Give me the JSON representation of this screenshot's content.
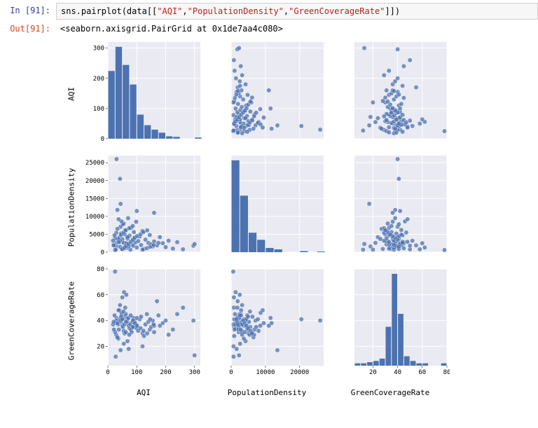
{
  "cell": {
    "in_prompt": "In [91]:",
    "out_prompt": "Out[91]:",
    "code_prefix": "sns.pairplot(data[[",
    "code_s1": "\"AQI\"",
    "code_c1": ",",
    "code_s2": "\"PopulationDensity\"",
    "code_c2": ",",
    "code_s3": "\"GreenCoverageRate\"",
    "code_suffix": "]])",
    "output_text": "<seaborn.axisgrid.PairGrid at 0x1de7aa4c080>"
  },
  "chart_data": {
    "type": "pairplot",
    "variables": [
      "AQI",
      "PopulationDensity",
      "GreenCoverageRate"
    ],
    "xlabels": [
      "AQI",
      "PopulationDensity",
      "GreenCoverageRate"
    ],
    "ylabels": [
      "AQI",
      "PopulationDensity",
      "GreenCoverageRate"
    ],
    "axes": {
      "AQI": {
        "min": 0,
        "max": 320,
        "ticks": [
          0,
          100,
          200,
          300
        ]
      },
      "PopulationDensity": {
        "min": 0,
        "max": 27000,
        "ticks": [
          0,
          10000,
          20000
        ]
      },
      "GreenCoverageRate": {
        "min": 5,
        "max": 80,
        "ticks": [
          20,
          40,
          60,
          80
        ]
      }
    },
    "yaxis_extra": {
      "AQI": {
        "ticks": [
          0,
          100,
          200,
          300
        ]
      },
      "PopulationDensity": {
        "ticks": [
          0,
          5000,
          10000,
          15000,
          20000,
          25000
        ]
      },
      "GreenCoverageRate": {
        "ticks": [
          20,
          40,
          60,
          80
        ]
      }
    },
    "diagonal": {
      "AQI": {
        "type": "hist",
        "bin_edges": [
          0,
          25,
          50,
          75,
          100,
          125,
          150,
          175,
          200,
          225,
          250,
          275,
          300,
          325
        ],
        "counts": [
          225,
          305,
          245,
          180,
          80,
          45,
          30,
          20,
          8,
          6,
          0,
          0,
          4
        ]
      },
      "PopulationDensity": {
        "type": "hist",
        "bin_edges": [
          0,
          2500,
          5000,
          7500,
          10000,
          12500,
          15000,
          17500,
          20000,
          22500,
          25000,
          27500
        ],
        "counts": [
          26000,
          16000,
          5500,
          3500,
          1200,
          800,
          0,
          0,
          300,
          0,
          200
        ]
      },
      "GreenCoverageRate": {
        "type": "hist",
        "bin_edges": [
          5,
          10,
          15,
          20,
          25,
          30,
          35,
          40,
          45,
          50,
          55,
          60,
          65,
          70,
          75,
          80
        ],
        "counts": [
          2,
          2,
          3,
          4,
          6,
          33,
          78,
          44,
          8,
          4,
          2,
          2,
          0,
          0,
          2
        ]
      }
    },
    "data_points": [
      {
        "AQI": 30,
        "PopulationDensity": 2600,
        "GreenCoverageRate": 42
      },
      {
        "AQI": 28,
        "PopulationDensity": 1700,
        "GreenCoverageRate": 38
      },
      {
        "AQI": 35,
        "PopulationDensity": 3400,
        "GreenCoverageRate": 37
      },
      {
        "AQI": 40,
        "PopulationDensity": 4200,
        "GreenCoverageRate": 41
      },
      {
        "AQI": 42,
        "PopulationDensity": 1500,
        "GreenCoverageRate": 40
      },
      {
        "AQI": 45,
        "PopulationDensity": 5200,
        "GreenCoverageRate": 39
      },
      {
        "AQI": 48,
        "PopulationDensity": 2900,
        "GreenCoverageRate": 44
      },
      {
        "AQI": 50,
        "PopulationDensity": 3600,
        "GreenCoverageRate": 36
      },
      {
        "AQI": 52,
        "PopulationDensity": 900,
        "GreenCoverageRate": 35
      },
      {
        "AQI": 55,
        "PopulationDensity": 8000,
        "GreenCoverageRate": 32
      },
      {
        "AQI": 58,
        "PopulationDensity": 5000,
        "GreenCoverageRate": 30
      },
      {
        "AQI": 60,
        "PopulationDensity": 6200,
        "GreenCoverageRate": 43
      },
      {
        "AQI": 62,
        "PopulationDensity": 2400,
        "GreenCoverageRate": 45
      },
      {
        "AQI": 65,
        "PopulationDensity": 1200,
        "GreenCoverageRate": 40
      },
      {
        "AQI": 68,
        "PopulationDensity": 3800,
        "GreenCoverageRate": 41
      },
      {
        "AQI": 70,
        "PopulationDensity": 9500,
        "GreenCoverageRate": 38
      },
      {
        "AQI": 72,
        "PopulationDensity": 2100,
        "GreenCoverageRate": 36
      },
      {
        "AQI": 75,
        "PopulationDensity": 4600,
        "GreenCoverageRate": 34
      },
      {
        "AQI": 78,
        "PopulationDensity": 700,
        "GreenCoverageRate": 37
      },
      {
        "AQI": 80,
        "PopulationDensity": 6800,
        "GreenCoverageRate": 33
      },
      {
        "AQI": 82,
        "PopulationDensity": 2200,
        "GreenCoverageRate": 31
      },
      {
        "AQI": 85,
        "PopulationDensity": 3300,
        "GreenCoverageRate": 39
      },
      {
        "AQI": 88,
        "PopulationDensity": 1800,
        "GreenCoverageRate": 42
      },
      {
        "AQI": 90,
        "PopulationDensity": 5600,
        "GreenCoverageRate": 35
      },
      {
        "AQI": 92,
        "PopulationDensity": 4100,
        "GreenCoverageRate": 40
      },
      {
        "AQI": 95,
        "PopulationDensity": 2700,
        "GreenCoverageRate": 38
      },
      {
        "AQI": 98,
        "PopulationDensity": 8500,
        "GreenCoverageRate": 36
      },
      {
        "AQI": 100,
        "PopulationDensity": 1300,
        "GreenCoverageRate": 34
      },
      {
        "AQI": 105,
        "PopulationDensity": 3100,
        "GreenCoverageRate": 32
      },
      {
        "AQI": 110,
        "PopulationDensity": 4400,
        "GreenCoverageRate": 41
      },
      {
        "AQI": 115,
        "PopulationDensity": 2000,
        "GreenCoverageRate": 43
      },
      {
        "AQI": 120,
        "PopulationDensity": 5900,
        "GreenCoverageRate": 30
      },
      {
        "AQI": 125,
        "PopulationDensity": 900,
        "GreenCoverageRate": 28
      },
      {
        "AQI": 130,
        "PopulationDensity": 3500,
        "GreenCoverageRate": 37
      },
      {
        "AQI": 135,
        "PopulationDensity": 1100,
        "GreenCoverageRate": 45
      },
      {
        "AQI": 140,
        "PopulationDensity": 2600,
        "GreenCoverageRate": 39
      },
      {
        "AQI": 145,
        "PopulationDensity": 4800,
        "GreenCoverageRate": 33
      },
      {
        "AQI": 150,
        "PopulationDensity": 2200,
        "GreenCoverageRate": 35
      },
      {
        "AQI": 155,
        "PopulationDensity": 1600,
        "GreenCoverageRate": 40
      },
      {
        "AQI": 160,
        "PopulationDensity": 3000,
        "GreenCoverageRate": 31
      },
      {
        "AQI": 170,
        "PopulationDensity": 1900,
        "GreenCoverageRate": 55
      },
      {
        "AQI": 180,
        "PopulationDensity": 4200,
        "GreenCoverageRate": 36
      },
      {
        "AQI": 190,
        "PopulationDensity": 2500,
        "GreenCoverageRate": 38
      },
      {
        "AQI": 200,
        "PopulationDensity": 1400,
        "GreenCoverageRate": 40
      },
      {
        "AQI": 210,
        "PopulationDensity": 3200,
        "GreenCoverageRate": 29
      },
      {
        "AQI": 225,
        "PopulationDensity": 1000,
        "GreenCoverageRate": 33
      },
      {
        "AQI": 240,
        "PopulationDensity": 2800,
        "GreenCoverageRate": 45
      },
      {
        "AQI": 260,
        "PopulationDensity": 800,
        "GreenCoverageRate": 50
      },
      {
        "AQI": 296,
        "PopulationDensity": 1800,
        "GreenCoverageRate": 40
      },
      {
        "AQI": 300,
        "PopulationDensity": 2300,
        "GreenCoverageRate": 13
      },
      {
        "AQI": 25,
        "PopulationDensity": 600,
        "GreenCoverageRate": 78
      },
      {
        "AQI": 30,
        "PopulationDensity": 26000,
        "GreenCoverageRate": 40
      },
      {
        "AQI": 42,
        "PopulationDensity": 20500,
        "GreenCoverageRate": 41
      },
      {
        "AQI": 33,
        "PopulationDensity": 11800,
        "GreenCoverageRate": 38
      },
      {
        "AQI": 160,
        "PopulationDensity": 11000,
        "GreenCoverageRate": 36
      },
      {
        "AQI": 44,
        "PopulationDensity": 13500,
        "GreenCoverageRate": 17
      },
      {
        "AQI": 27,
        "PopulationDensity": 700,
        "GreenCoverageRate": 12
      },
      {
        "AQI": 55,
        "PopulationDensity": 2600,
        "GreenCoverageRate": 22
      },
      {
        "AQI": 40,
        "PopulationDensity": 2900,
        "GreenCoverageRate": 48
      },
      {
        "AQI": 60,
        "PopulationDensity": 1800,
        "GreenCoverageRate": 50
      },
      {
        "AQI": 42,
        "PopulationDensity": 3200,
        "GreenCoverageRate": 52
      },
      {
        "AQI": 50,
        "PopulationDensity": 800,
        "GreenCoverageRate": 58
      },
      {
        "AQI": 68,
        "PopulationDensity": 4200,
        "GreenCoverageRate": 24
      },
      {
        "AQI": 36,
        "PopulationDensity": 3700,
        "GreenCoverageRate": 26
      },
      {
        "AQI": 44,
        "PopulationDensity": 7100,
        "GreenCoverageRate": 40
      },
      {
        "AQI": 52,
        "PopulationDensity": 7800,
        "GreenCoverageRate": 41
      },
      {
        "AQI": 47,
        "PopulationDensity": 8600,
        "GreenCoverageRate": 46
      },
      {
        "AQI": 37,
        "PopulationDensity": 9200,
        "GreenCoverageRate": 48
      },
      {
        "AQI": 29,
        "PopulationDensity": 5400,
        "GreenCoverageRate": 29
      },
      {
        "AQI": 33,
        "PopulationDensity": 6500,
        "GreenCoverageRate": 27
      },
      {
        "AQI": 25,
        "PopulationDensity": 3900,
        "GreenCoverageRate": 31
      },
      {
        "AQI": 21,
        "PopulationDensity": 2100,
        "GreenCoverageRate": 33
      },
      {
        "AQI": 23,
        "PopulationDensity": 4700,
        "GreenCoverageRate": 44
      },
      {
        "AQI": 100,
        "PopulationDensity": 11500,
        "GreenCoverageRate": 42
      },
      {
        "AQI": 56,
        "PopulationDensity": 1300,
        "GreenCoverageRate": 62
      },
      {
        "AQI": 64,
        "PopulationDensity": 2500,
        "GreenCoverageRate": 60
      },
      {
        "AQI": 72,
        "PopulationDensity": 1600,
        "GreenCoverageRate": 18
      },
      {
        "AQI": 120,
        "PopulationDensity": 700,
        "GreenCoverageRate": 20
      },
      {
        "AQI": 18,
        "PopulationDensity": 3200,
        "GreenCoverageRate": 37
      },
      {
        "AQI": 20,
        "PopulationDensity": 1900,
        "GreenCoverageRate": 39
      },
      {
        "AQI": 46,
        "PopulationDensity": 4900,
        "GreenCoverageRate": 43
      },
      {
        "AQI": 54,
        "PopulationDensity": 5500,
        "GreenCoverageRate": 47
      },
      {
        "AQI": 62,
        "PopulationDensity": 6100,
        "GreenCoverageRate": 31
      },
      {
        "AQI": 74,
        "PopulationDensity": 6700,
        "GreenCoverageRate": 29
      },
      {
        "AQI": 86,
        "PopulationDensity": 7300,
        "GreenCoverageRate": 35
      },
      {
        "AQI": 38,
        "PopulationDensity": 2800,
        "GreenCoverageRate": 33
      },
      {
        "AQI": 49,
        "PopulationDensity": 900,
        "GreenCoverageRate": 41
      },
      {
        "AQI": 57,
        "PopulationDensity": 1200,
        "GreenCoverageRate": 37
      },
      {
        "AQI": 63,
        "PopulationDensity": 1700,
        "GreenCoverageRate": 39
      },
      {
        "AQI": 71,
        "PopulationDensity": 2300,
        "GreenCoverageRate": 42
      },
      {
        "AQI": 79,
        "PopulationDensity": 2900,
        "GreenCoverageRate": 44
      },
      {
        "AQI": 87,
        "PopulationDensity": 3500,
        "GreenCoverageRate": 40
      },
      {
        "AQI": 93,
        "PopulationDensity": 4000,
        "GreenCoverageRate": 38
      },
      {
        "AQI": 101,
        "PopulationDensity": 4500,
        "GreenCoverageRate": 36
      },
      {
        "AQI": 113,
        "PopulationDensity": 5000,
        "GreenCoverageRate": 34
      },
      {
        "AQI": 123,
        "PopulationDensity": 5600,
        "GreenCoverageRate": 32
      },
      {
        "AQI": 136,
        "PopulationDensity": 6100,
        "GreenCoverageRate": 30
      },
      {
        "AQI": 146,
        "PopulationDensity": 1500,
        "GreenCoverageRate": 41
      },
      {
        "AQI": 158,
        "PopulationDensity": 2000,
        "GreenCoverageRate": 37
      },
      {
        "AQI": 175,
        "PopulationDensity": 2600,
        "GreenCoverageRate": 44
      }
    ]
  }
}
